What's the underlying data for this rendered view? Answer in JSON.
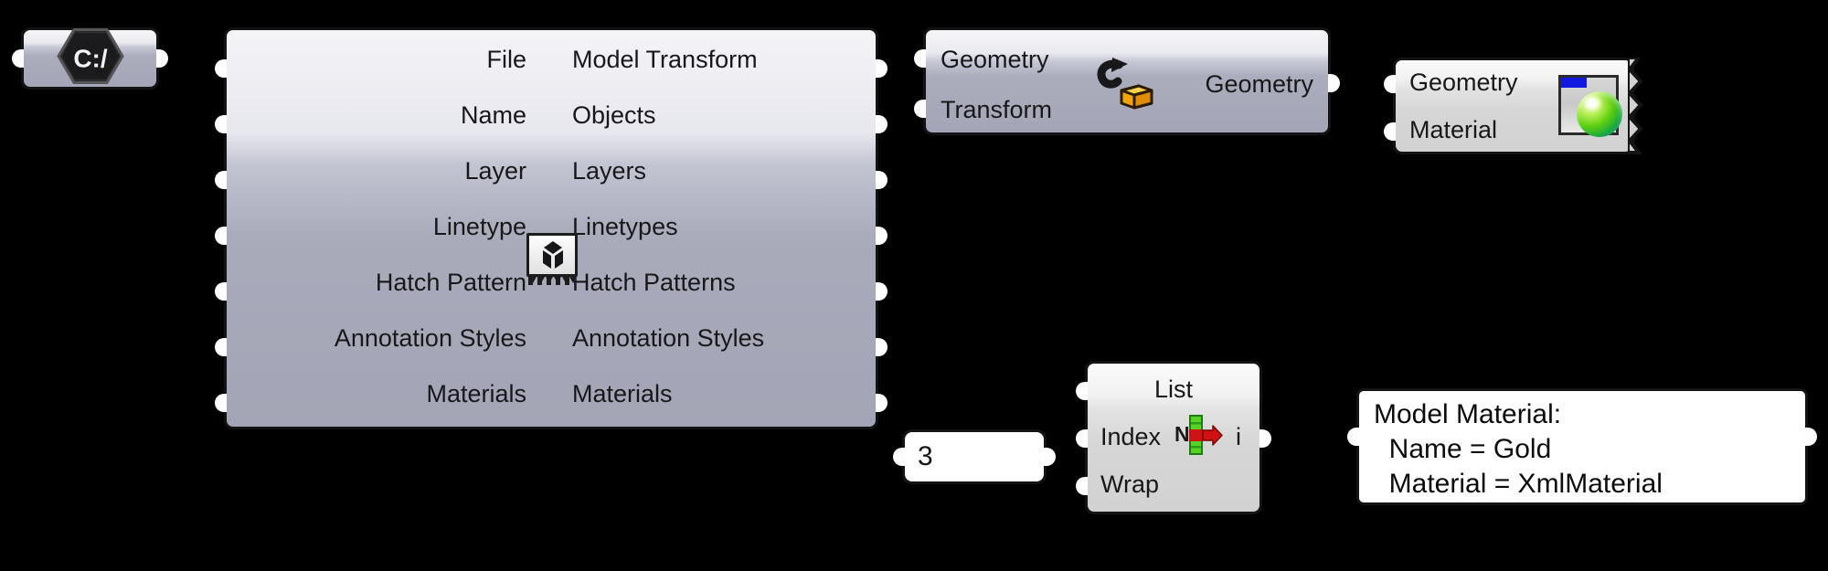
{
  "canvas": {
    "background": "#000000",
    "node_body_color": "#a5a7b8",
    "node_light_color": "#d6d6d6",
    "port_color": "#fdfdfd",
    "outline_color": "#141414"
  },
  "nodes": {
    "file_path": {
      "name": "file-path-node",
      "icon": "c-drive-hex-icon",
      "icon_text": "C:/",
      "ports": {
        "input": "",
        "output": ""
      }
    },
    "model_reader": {
      "name": "rhino-3dm-file-reader-node",
      "icon": "3dm-file-icon",
      "inputs": [
        "File",
        "Name",
        "Layer",
        "Linetype",
        "Hatch Pattern",
        "Annotation Styles",
        "Materials"
      ],
      "outputs": [
        "Model Transform",
        "Objects",
        "Layers",
        "Linetypes",
        "Hatch Patterns",
        "Annotation Styles",
        "Materials"
      ]
    },
    "geometry_transform": {
      "name": "geometry-transform-node",
      "icon": "transform-arrow-box-icon",
      "inputs": [
        "Geometry",
        "Transform"
      ],
      "outputs": [
        "Geometry"
      ]
    },
    "material_node": {
      "name": "geometry-material-node",
      "icon": "material-sphere-icon",
      "inputs": [
        "Geometry",
        "Material"
      ],
      "edge_style": "jagged"
    },
    "list_item": {
      "name": "list-item-node",
      "icon": "list-index-arrow-icon",
      "inputs": [
        "List",
        "Index",
        "Wrap"
      ],
      "outputs": [
        "i"
      ]
    },
    "number_panel": {
      "name": "number-panel",
      "value": "3"
    },
    "result_panel": {
      "name": "model-material-result-panel",
      "lines": [
        "Model Material:",
        "  Name = Gold",
        "  Material = XmlMaterial"
      ],
      "text": "Model Material:\n  Name = Gold\n  Material = XmlMaterial"
    }
  }
}
